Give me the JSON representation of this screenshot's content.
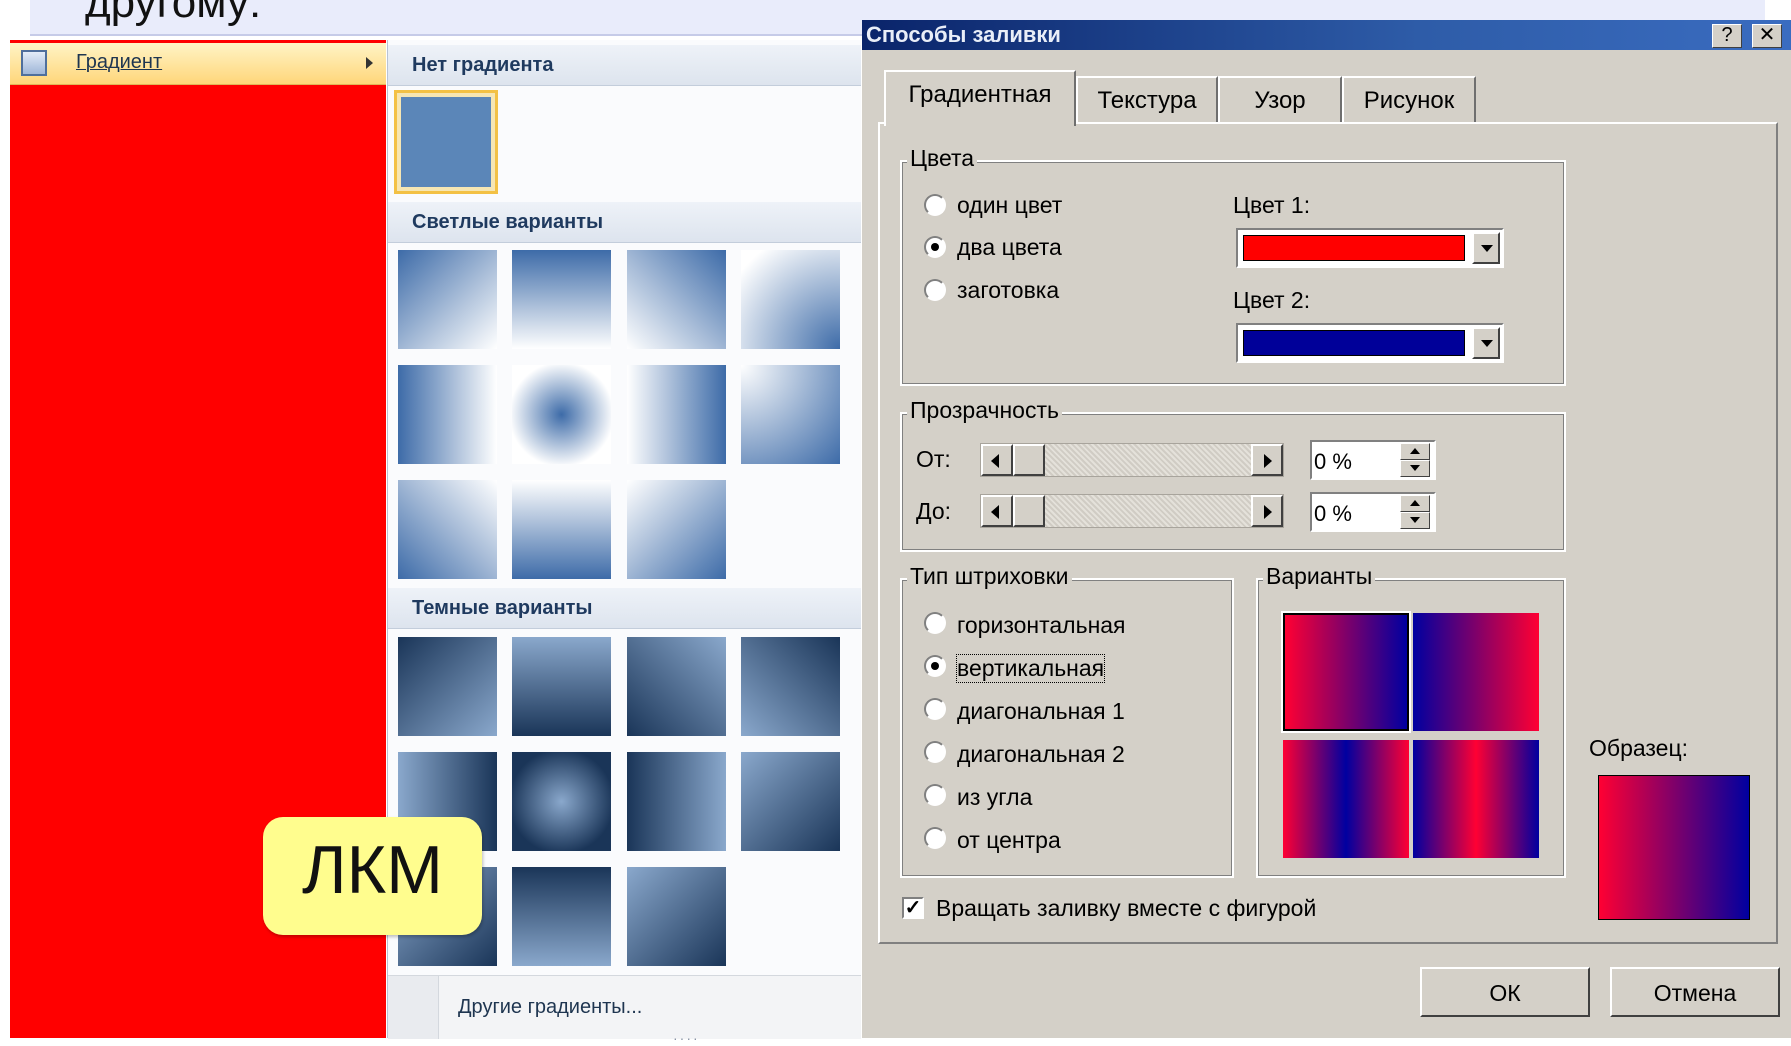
{
  "slide": {
    "caption_text": "другому:"
  },
  "menu": {
    "gradient_item_label": "Градиент"
  },
  "gallery": {
    "no_gradient_header": "Нет градиента",
    "light_header": "Светлые варианты",
    "dark_header": "Темные варианты",
    "more_gradients_label": "Другие градиенты...",
    "grip": "····"
  },
  "tooltip": {
    "text": "ЛКМ"
  },
  "dialog": {
    "title": "Способы заливки",
    "titlebar_buttons": {
      "help": "?",
      "close": "✕"
    },
    "tabs": [
      {
        "label": "Градиентная",
        "active": true
      },
      {
        "label": "Текстура",
        "active": false
      },
      {
        "label": "Узор",
        "active": false
      },
      {
        "label": "Рисунок",
        "active": false
      }
    ],
    "colors_group": {
      "title": "Цвета",
      "options": [
        "один цвет",
        "два цвета",
        "заготовка"
      ],
      "selected": "два цвета",
      "color1_label": "Цвет 1:",
      "color2_label": "Цвет 2:",
      "color1_value": "#ff0000",
      "color2_value": "#000099"
    },
    "transparency_group": {
      "title": "Прозрачность",
      "from_label": "От:",
      "to_label": "До:",
      "from_value": "0 %",
      "to_value": "0 %"
    },
    "hatch_group": {
      "title": "Тип штриховки",
      "options": [
        "горизонтальная",
        "вертикальная",
        "диагональная 1",
        "диагональная 2",
        "из угла",
        "от центра"
      ],
      "selected": "вертикальная"
    },
    "variants_group": {
      "title": "Варианты"
    },
    "sample_label": "Образец:",
    "rotate_checkbox": {
      "label": "Вращать заливку вместе с фигурой",
      "checked": true
    },
    "ok_label": "ОК",
    "cancel_label": "Отмена"
  }
}
